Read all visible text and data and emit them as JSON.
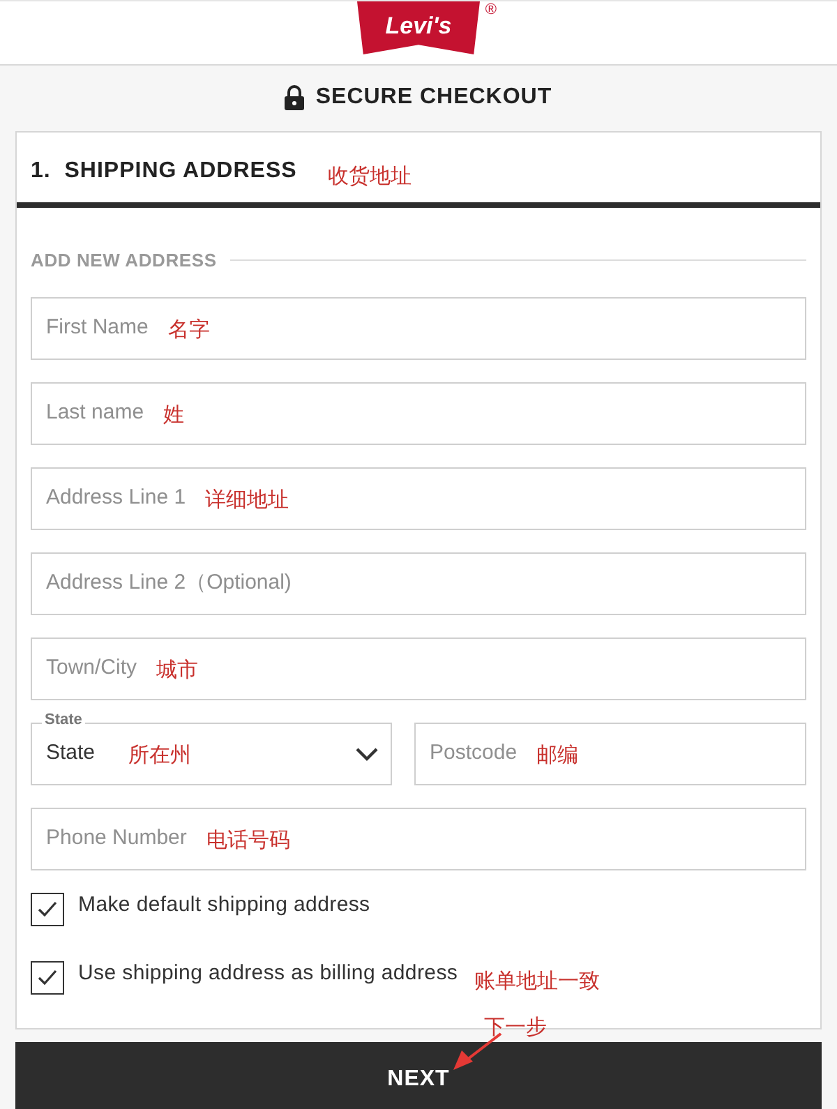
{
  "logo": {
    "text": "Levi's",
    "mark": "®"
  },
  "title": "SECURE CHECKOUT",
  "section": {
    "heading": "1.  SHIPPING ADDRESS",
    "note": "收货地址"
  },
  "subheading": "ADD NEW ADDRESS",
  "rows": [
    [
      {
        "kind": "text",
        "placeholder": "First Name",
        "note": "名字"
      }
    ],
    [
      {
        "kind": "text",
        "placeholder": "Last name",
        "note": "姓"
      }
    ],
    [
      {
        "kind": "text",
        "placeholder": "Address Line 1",
        "note": "详细地址"
      }
    ],
    [
      {
        "kind": "text",
        "placeholder": "Address Line 2（Optional)"
      }
    ],
    [
      {
        "kind": "text",
        "placeholder": "Town/City",
        "note": "城市"
      }
    ],
    [
      {
        "kind": "select",
        "label": "State",
        "value": "State",
        "note": "所在州"
      },
      {
        "kind": "text",
        "placeholder": "Postcode",
        "note": "邮编"
      }
    ],
    [
      {
        "kind": "text",
        "placeholder": "Phone Number",
        "note": "电话号码"
      }
    ]
  ],
  "checkboxes": [
    {
      "label": "Make default shipping address",
      "checked": true
    },
    {
      "label": "Use shipping address as billing address",
      "checked": true,
      "note": "账单地址一致"
    }
  ],
  "button": {
    "label": "NEXT",
    "note": "下一步"
  }
}
